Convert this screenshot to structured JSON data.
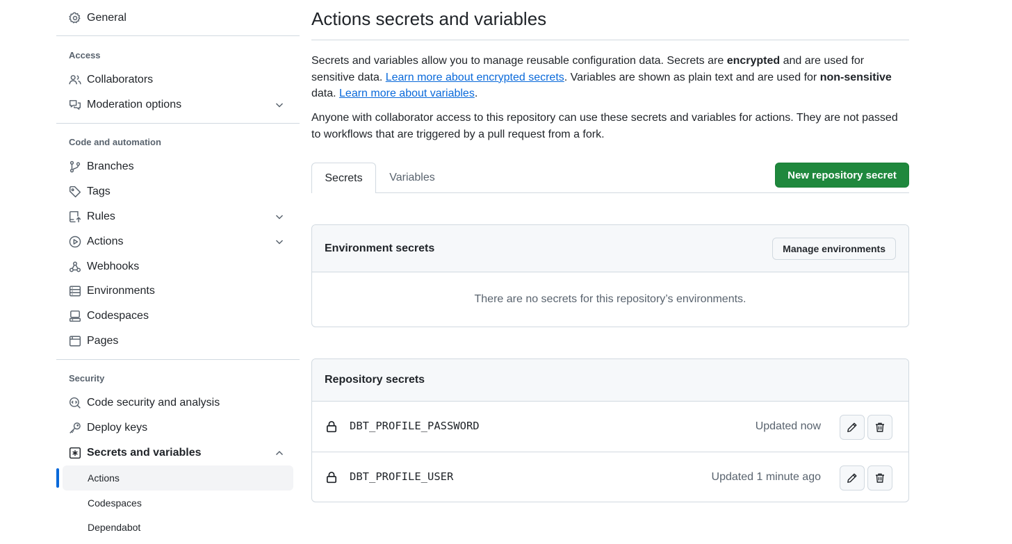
{
  "sidebar": {
    "general": "General",
    "access_head": "Access",
    "collaborators": "Collaborators",
    "moderation": "Moderation options",
    "code_head": "Code and automation",
    "branches": "Branches",
    "tags": "Tags",
    "rules": "Rules",
    "actions": "Actions",
    "webhooks": "Webhooks",
    "environments": "Environments",
    "codespaces": "Codespaces",
    "pages": "Pages",
    "security_head": "Security",
    "code_security": "Code security and analysis",
    "deploy_keys": "Deploy keys",
    "secrets_vars": "Secrets and variables",
    "sub_actions": "Actions",
    "sub_codespaces": "Codespaces",
    "sub_dependabot": "Dependabot"
  },
  "main": {
    "title": "Actions secrets and variables",
    "intro": {
      "p1_a": "Secrets and variables allow you to manage reusable configuration data. Secrets are ",
      "p1_b": "encrypted",
      "p1_c": " and are used for sensitive data. ",
      "p1_link1": "Learn more about encrypted secrets",
      "p1_d": ". Variables are shown as plain text and are used for ",
      "p1_e": "non-sensitive",
      "p1_f": " data. ",
      "p1_link2": "Learn more about variables",
      "p1_g": ".",
      "p2": "Anyone with collaborator access to this repository can use these secrets and variables for actions. They are not passed to workflows that are triggered by a pull request from a fork."
    },
    "tabs": {
      "secrets": "Secrets",
      "variables": "Variables"
    },
    "new_secret_button": "New repository secret",
    "env_secrets": {
      "title": "Environment secrets",
      "manage_button": "Manage environments",
      "empty": "There are no secrets for this repository’s environments."
    },
    "repo_secrets": {
      "title": "Repository secrets",
      "rows": [
        {
          "name": "DBT_PROFILE_PASSWORD",
          "updated": "Updated now"
        },
        {
          "name": "DBT_PROFILE_USER",
          "updated": "Updated 1 minute ago"
        }
      ]
    }
  },
  "colors": {
    "accent": "#0969da",
    "primary_button": "#1f883d",
    "border": "#d1d9e0",
    "muted_text": "#59636e"
  }
}
